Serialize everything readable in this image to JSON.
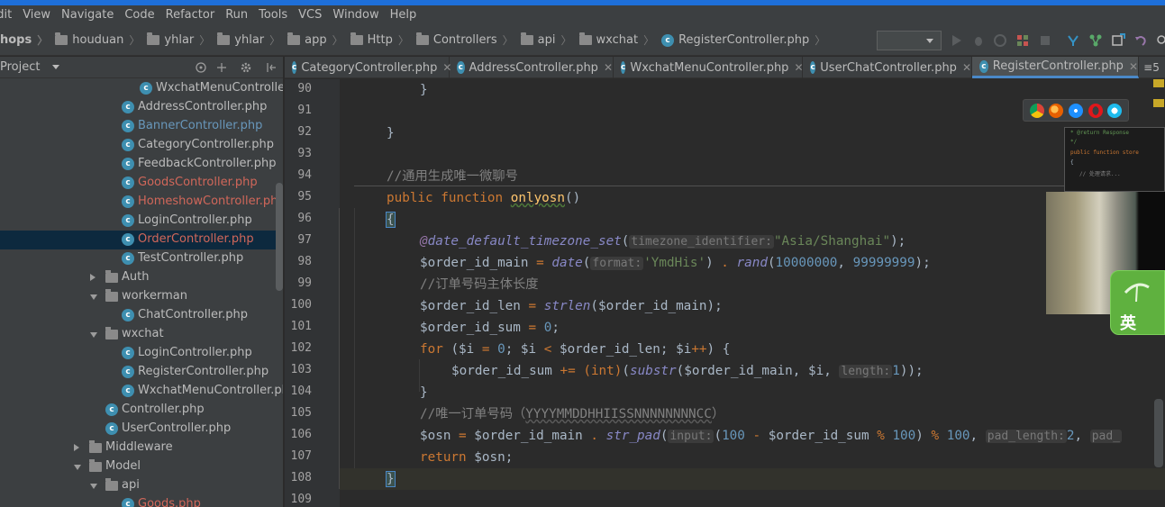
{
  "menubar": {
    "items": [
      "Edit",
      "View",
      "Navigate",
      "Code",
      "Refactor",
      "Run",
      "Tools",
      "VCS",
      "Window",
      "Help"
    ]
  },
  "breadcrumb": [
    "hops",
    "houduan",
    "yhlar",
    "yhlar",
    "app",
    "Http",
    "Controllers",
    "api",
    "wxchat",
    "RegisterController.php"
  ],
  "project_panel": {
    "title": "Project",
    "tree": [
      {
        "label": "WxchatMenuController.p",
        "kind": "file",
        "status": "normal"
      },
      {
        "label": "AddressController.php",
        "kind": "file",
        "status": "normal"
      },
      {
        "label": "BannerController.php",
        "kind": "file",
        "status": "modified"
      },
      {
        "label": "CategoryController.php",
        "kind": "file",
        "status": "normal"
      },
      {
        "label": "FeedbackController.php",
        "kind": "file",
        "status": "normal"
      },
      {
        "label": "GoodsController.php",
        "kind": "file",
        "status": "untracked"
      },
      {
        "label": "HomeshowController.php",
        "kind": "file",
        "status": "untracked"
      },
      {
        "label": "LoginController.php",
        "kind": "file",
        "status": "normal"
      },
      {
        "label": "OrderController.php",
        "kind": "file",
        "status": "untracked",
        "selected": true
      },
      {
        "label": "TestController.php",
        "kind": "file",
        "status": "normal"
      },
      {
        "label": "Auth",
        "kind": "folder",
        "expanded": false
      },
      {
        "label": "workerman",
        "kind": "folder",
        "expanded": true
      },
      {
        "label": "ChatController.php",
        "kind": "file",
        "status": "normal"
      },
      {
        "label": "wxchat",
        "kind": "folder",
        "expanded": true
      },
      {
        "label": "LoginController.php",
        "kind": "file",
        "status": "normal"
      },
      {
        "label": "RegisterController.php",
        "kind": "file",
        "status": "normal"
      },
      {
        "label": "WxchatMenuController.php",
        "kind": "file",
        "status": "normal"
      },
      {
        "label": "Controller.php",
        "kind": "file",
        "status": "normal"
      },
      {
        "label": "UserController.php",
        "kind": "file",
        "status": "normal"
      },
      {
        "label": "Middleware",
        "kind": "folder",
        "expanded": false
      },
      {
        "label": "Model",
        "kind": "folder",
        "expanded": true
      },
      {
        "label": "api",
        "kind": "folder",
        "expanded": true
      },
      {
        "label": "Goods.php",
        "kind": "file",
        "status": "untracked"
      }
    ]
  },
  "tabs": [
    {
      "label": "CategoryController.php",
      "active": false
    },
    {
      "label": "AddressController.php",
      "active": false
    },
    {
      "label": "WxchatMenuController.php",
      "active": false
    },
    {
      "label": "UserChatController.php",
      "active": false
    },
    {
      "label": "RegisterController.php",
      "active": true
    }
  ],
  "tab_overflow": "≡5",
  "editor": {
    "line_numbers": [
      "90",
      "91",
      "92",
      "93",
      "94",
      "95",
      "96",
      "97",
      "98",
      "99",
      "100",
      "101",
      "102",
      "103",
      "104",
      "105",
      "106",
      "107",
      "108",
      "109"
    ],
    "current_line": "108",
    "comment_94": "//通用生成唯一微聊号",
    "kw_public": "public",
    "kw_function": "function",
    "fn_name": "onlyosn",
    "at_sign": "@",
    "fn_date_default": "date_default_timezone_set",
    "hint_timezone": "timezone_identifier:",
    "str_asia": "\"Asia/Shanghai\"",
    "var_order_id_main": "$order_id_main",
    "fn_date": "date",
    "hint_format": "format:",
    "str_ymdhis": "'YmdHis'",
    "fn_rand": "rand",
    "num_1e7": "10000000",
    "num_99999999": "99999999",
    "comment_99": "//订单号码主体长度",
    "var_order_id_len": "$order_id_len",
    "fn_strlen": "strlen",
    "var_order_id_sum": "$order_id_sum",
    "num_0": "0",
    "kw_for": "for",
    "var_i": "$i",
    "kw_int": "(int)",
    "fn_substr": "substr",
    "hint_length": "length:",
    "num_1": "1",
    "comment_105": "//唯一订单号码（",
    "comment_105_u": "YYYYMMDDHHIISSNNNNNNNNCC",
    "comment_105_end": "）",
    "var_osn": "$osn",
    "fn_str_pad": "str_pad",
    "hint_input": "input:",
    "num_100": "100",
    "hint_pad_length": "pad_length:",
    "num_2": "2",
    "hint_pad": "pad_",
    "kw_return": "return",
    "brace_open": "{",
    "brace_close": "}"
  },
  "ime": {
    "label": "英"
  },
  "colors": {
    "keyword": "#cc7832",
    "function_def": "#ffc66d",
    "string": "#6a8759",
    "number": "#6897bb",
    "comment": "#808080",
    "builtin_call": "#8888c6",
    "annotation": "#9876aa",
    "modified_file": "#6897bb",
    "untracked_file": "#d1675a",
    "selection": "#0d293e",
    "accent": "#4a88c7"
  }
}
